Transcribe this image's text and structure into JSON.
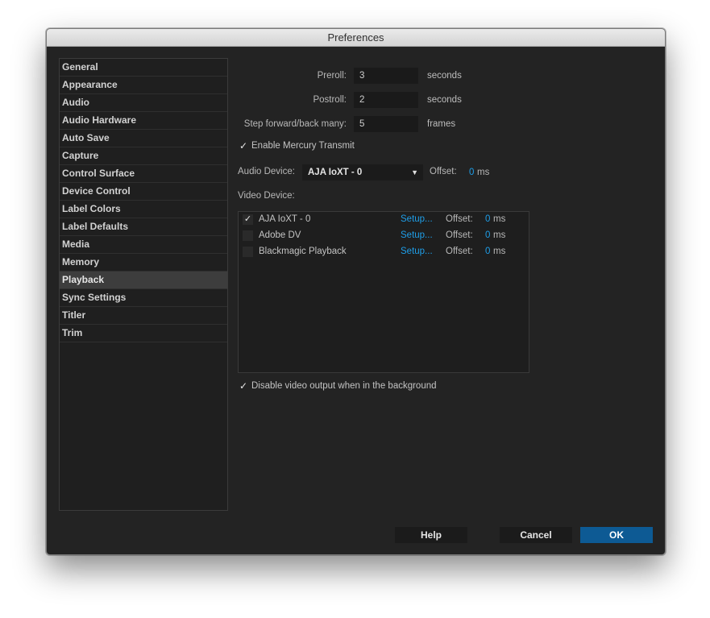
{
  "window": {
    "title": "Preferences"
  },
  "sidebar": {
    "items": [
      {
        "label": "General"
      },
      {
        "label": "Appearance"
      },
      {
        "label": "Audio"
      },
      {
        "label": "Audio Hardware"
      },
      {
        "label": "Auto Save"
      },
      {
        "label": "Capture"
      },
      {
        "label": "Control Surface"
      },
      {
        "label": "Device Control"
      },
      {
        "label": "Label Colors"
      },
      {
        "label": "Label Defaults"
      },
      {
        "label": "Media"
      },
      {
        "label": "Memory"
      },
      {
        "label": "Playback",
        "selected": true
      },
      {
        "label": "Sync Settings"
      },
      {
        "label": "Titler"
      },
      {
        "label": "Trim"
      }
    ]
  },
  "playback": {
    "preroll": {
      "label": "Preroll:",
      "value": "3",
      "unit": "seconds"
    },
    "postroll": {
      "label": "Postroll:",
      "value": "2",
      "unit": "seconds"
    },
    "step": {
      "label": "Step forward/back many:",
      "value": "5",
      "unit": "frames"
    },
    "mercury": {
      "check": "✓",
      "label": "Enable Mercury Transmit",
      "checked": true
    },
    "audio_device": {
      "label": "Audio Device:",
      "selected": "AJA IoXT - 0",
      "offset_label": "Offset:",
      "offset_value": "0",
      "offset_unit": "ms"
    },
    "video_device_label": "Video Device:",
    "video_devices": [
      {
        "check": "✓",
        "checked": true,
        "name": "AJA IoXT - 0",
        "setup": "Setup...",
        "offset_label": "Offset:",
        "offset_value": "0",
        "offset_unit": "ms"
      },
      {
        "check": "",
        "checked": false,
        "name": "Adobe DV",
        "setup": "Setup...",
        "offset_label": "Offset:",
        "offset_value": "0",
        "offset_unit": "ms"
      },
      {
        "check": "",
        "checked": false,
        "name": "Blackmagic Playback",
        "setup": "Setup...",
        "offset_label": "Offset:",
        "offset_value": "0",
        "offset_unit": "ms"
      }
    ],
    "disable_bg": {
      "check": "✓",
      "label": "Disable video output when in the background",
      "checked": true
    }
  },
  "buttons": {
    "help": "Help",
    "cancel": "Cancel",
    "ok": "OK"
  },
  "colors": {
    "accent": "#1e9ee8",
    "ok_button": "#0d5a94",
    "background": "#232323"
  }
}
